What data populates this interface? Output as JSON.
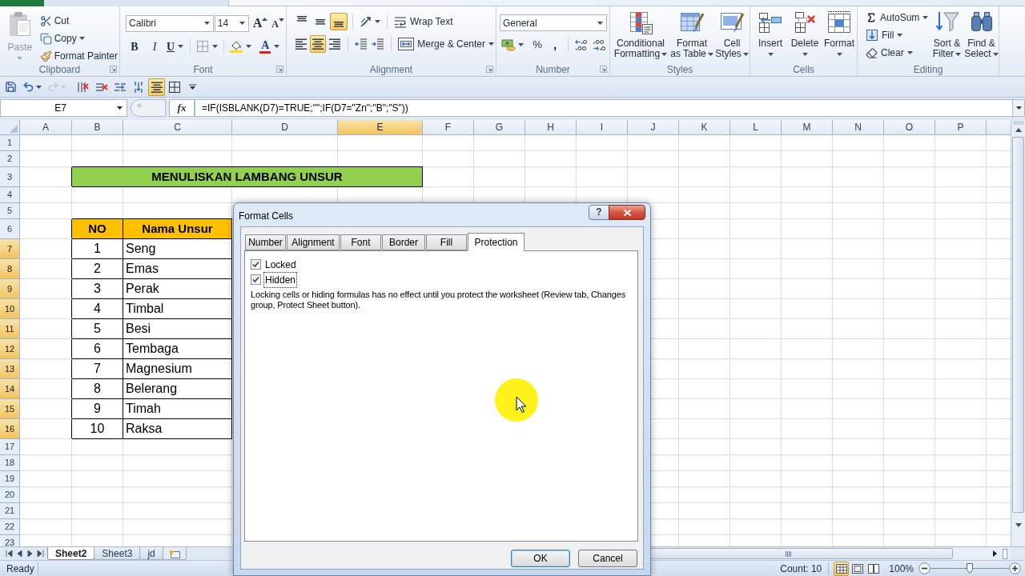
{
  "ribbon": {
    "clipboard": {
      "label": "Clipboard",
      "paste": {
        "label": "Paste",
        "disabled": true
      },
      "tools": [
        {
          "kind": "cut",
          "label": "Cut",
          "dropdown": false
        },
        {
          "kind": "copy",
          "label": "Copy",
          "dropdown": true
        },
        {
          "kind": "painter",
          "label": "Format Painter",
          "dropdown": false
        }
      ]
    },
    "font": {
      "label": "Font",
      "font_name": "Calibri",
      "font_size": "14",
      "grow": "A",
      "shrink": "A",
      "bold": "B",
      "italic": "I",
      "underline": "U",
      "font_color": "A"
    },
    "alignment": {
      "label": "Alignment",
      "vertical": [
        {
          "kind": "top",
          "selected": false
        },
        {
          "kind": "middle",
          "selected": false
        },
        {
          "kind": "bottom",
          "selected": true
        }
      ],
      "horizontal": [
        {
          "kind": "left",
          "selected": false
        },
        {
          "kind": "center",
          "selected": true
        },
        {
          "kind": "right",
          "selected": false
        }
      ],
      "wrap_text": "Wrap Text",
      "merge": "Merge & Center"
    },
    "number": {
      "label": "Number",
      "format": "General",
      "percent": "%",
      "comma": ","
    },
    "styles": {
      "label": "Styles",
      "buttons": [
        {
          "kind": "conditional",
          "lines": [
            "Conditional",
            "Formatting"
          ]
        },
        {
          "kind": "table",
          "lines": [
            "Format",
            "as Table"
          ]
        },
        {
          "kind": "cell_styles",
          "lines": [
            "Cell",
            "Styles"
          ]
        }
      ]
    },
    "cells": {
      "label": "Cells",
      "buttons": [
        {
          "kind": "insert",
          "label": "Insert"
        },
        {
          "kind": "delete",
          "label": "Delete"
        },
        {
          "kind": "format",
          "label": "Format"
        }
      ]
    },
    "editing": {
      "label": "Editing",
      "tools": [
        {
          "kind": "autosum",
          "label": "AutoSum"
        },
        {
          "kind": "fill",
          "label": "Fill"
        },
        {
          "kind": "clear",
          "label": "Clear"
        }
      ],
      "buttons": [
        {
          "kind": "sort",
          "lines": [
            "Sort &",
            "Filter"
          ]
        },
        {
          "kind": "find",
          "lines": [
            "Find &",
            "Select"
          ]
        }
      ]
    }
  },
  "quick_access": [
    {
      "kind": "save",
      "selected": false,
      "disabled": false
    },
    {
      "kind": "undo",
      "selected": false,
      "disabled": false
    },
    {
      "kind": "redo",
      "selected": false,
      "disabled": true
    },
    {
      "kind": "delete_columns",
      "selected": false,
      "disabled": false
    },
    {
      "kind": "delete_rows",
      "selected": false,
      "disabled": false
    },
    {
      "kind": "insert_cells",
      "selected": false,
      "disabled": false
    },
    {
      "kind": "insert_rows",
      "selected": false,
      "disabled": false
    },
    {
      "kind": "align_center",
      "selected": true,
      "disabled": false
    },
    {
      "kind": "borders",
      "selected": false,
      "disabled": false
    },
    {
      "kind": "customize",
      "selected": false,
      "disabled": false
    }
  ],
  "formula_bar": {
    "name_box": "E7",
    "function_button": "fx",
    "formula": "=IF(ISBLANK(D7)=TRUE;\"\";IF(D7=\"Zn\";\"B\";\"S\"))"
  },
  "sheet": {
    "columns": [
      {
        "label": "A",
        "selected": false
      },
      {
        "label": "B",
        "selected": false
      },
      {
        "label": "C",
        "selected": false
      },
      {
        "label": "D",
        "selected": false
      },
      {
        "label": "E",
        "selected": true
      },
      {
        "label": "F",
        "selected": false
      },
      {
        "label": "G",
        "selected": false
      },
      {
        "label": "H",
        "selected": false
      },
      {
        "label": "I",
        "selected": false
      },
      {
        "label": "J",
        "selected": false
      },
      {
        "label": "K",
        "selected": false
      },
      {
        "label": "L",
        "selected": false
      },
      {
        "label": "M",
        "selected": false
      },
      {
        "label": "N",
        "selected": false
      },
      {
        "label": "O",
        "selected": false
      },
      {
        "label": "P",
        "selected": false
      }
    ],
    "rows": [
      {
        "label": "1",
        "selected": false,
        "kind": "blank"
      },
      {
        "label": "2",
        "selected": false,
        "kind": "blank"
      },
      {
        "label": "3",
        "selected": false,
        "kind": "title",
        "cells": [
          "MENULISKAN LAMBANG UNSUR"
        ]
      },
      {
        "label": "4",
        "selected": false,
        "kind": "blank"
      },
      {
        "label": "5",
        "selected": false,
        "kind": "blank"
      },
      {
        "label": "6",
        "selected": false,
        "kind": "header",
        "cells": [
          "NO",
          "Nama Unsur"
        ]
      },
      {
        "label": "7",
        "selected": true,
        "kind": "data",
        "cells": [
          "1",
          "Seng"
        ]
      },
      {
        "label": "8",
        "selected": true,
        "kind": "data",
        "cells": [
          "2",
          "Emas"
        ]
      },
      {
        "label": "9",
        "selected": true,
        "kind": "data",
        "cells": [
          "3",
          "Perak"
        ]
      },
      {
        "label": "10",
        "selected": true,
        "kind": "data",
        "cells": [
          "4",
          "Timbal"
        ]
      },
      {
        "label": "11",
        "selected": true,
        "kind": "data",
        "cells": [
          "5",
          "Besi"
        ]
      },
      {
        "label": "12",
        "selected": true,
        "kind": "data",
        "cells": [
          "6",
          "Tembaga"
        ]
      },
      {
        "label": "13",
        "selected": true,
        "kind": "data",
        "cells": [
          "7",
          "Magnesium"
        ]
      },
      {
        "label": "14",
        "selected": true,
        "kind": "data",
        "cells": [
          "8",
          "Belerang"
        ]
      },
      {
        "label": "15",
        "selected": true,
        "kind": "data",
        "cells": [
          "9",
          "Timah"
        ]
      },
      {
        "label": "16",
        "selected": true,
        "kind": "data",
        "cells": [
          "10",
          "Raksa"
        ]
      },
      {
        "label": "17",
        "selected": false,
        "kind": "blank"
      },
      {
        "label": "18",
        "selected": false,
        "kind": "blank"
      },
      {
        "label": "19",
        "selected": false,
        "kind": "blank"
      },
      {
        "label": "20",
        "selected": false,
        "kind": "blank"
      },
      {
        "label": "21",
        "selected": false,
        "kind": "blank"
      },
      {
        "label": "22",
        "selected": false,
        "kind": "blank"
      },
      {
        "label": "23",
        "selected": false,
        "kind": "blank"
      }
    ]
  },
  "sheet_tabs": [
    {
      "label": "Sheet2",
      "selected": true
    },
    {
      "label": "Sheet3",
      "selected": false
    },
    {
      "label": "jd",
      "selected": false
    }
  ],
  "status_bar": {
    "status": "Ready",
    "count": "Count: 10",
    "views": [
      {
        "kind": "normal",
        "selected": true
      },
      {
        "kind": "page_layout",
        "selected": false
      },
      {
        "kind": "page_break",
        "selected": false
      }
    ],
    "zoom": "100%",
    "zoom_slider": {
      "level": 0.5
    }
  },
  "dialog": {
    "title": "Format Cells",
    "help": "?",
    "tabs": [
      {
        "label": "Number",
        "selected": false
      },
      {
        "label": "Alignment",
        "selected": false
      },
      {
        "label": "Font",
        "selected": false
      },
      {
        "label": "Border",
        "selected": false
      },
      {
        "label": "Fill",
        "selected": false
      },
      {
        "label": "Protection",
        "selected": true
      }
    ],
    "checkboxes": [
      {
        "label": "Locked",
        "checked": true,
        "focused": false
      },
      {
        "label": "Hidden",
        "checked": true,
        "focused": true
      }
    ],
    "note": "Locking cells or hiding formulas has no effect until you protect the worksheet (Review tab, Changes group, Protect Sheet button).",
    "buttons": [
      {
        "label": "OK",
        "default": true
      },
      {
        "label": "Cancel",
        "default": false
      }
    ]
  }
}
